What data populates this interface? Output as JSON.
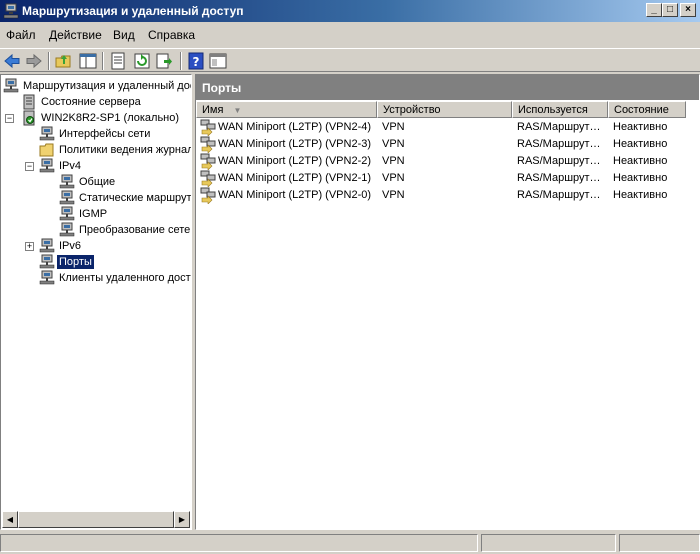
{
  "window": {
    "title": "Маршрутизация и удаленный доступ",
    "buttons": {
      "minimize": "_",
      "maximize": "□",
      "close": "×"
    }
  },
  "menu": [
    "Файл",
    "Действие",
    "Вид",
    "Справка"
  ],
  "toolbar": {
    "icons": [
      "back-arrow-icon",
      "forward-arrow-icon",
      "up-folder-icon",
      "show-tree-icon",
      "properties-icon",
      "refresh-icon",
      "export-icon",
      "help-icon",
      "console-icon"
    ],
    "accent": "#0a246a"
  },
  "tree": [
    {
      "label": "Маршрутизация и удаленный доступ",
      "icon": "server-tree-icon"
    },
    {
      "label": "Состояние сервера",
      "icon": "server-status-icon"
    },
    {
      "label": "WIN2K8R2-SP1 (локально)",
      "icon": "server-icon",
      "expander": "−"
    },
    {
      "label": "Интерфейсы сети",
      "icon": "network-icon"
    },
    {
      "label": "Политики ведения журнала",
      "icon": "folder-icon"
    },
    {
      "label": "IPv4",
      "icon": "network-icon",
      "expander": "−"
    },
    {
      "label": "Общие",
      "icon": "network-icon"
    },
    {
      "label": "Статические маршруты",
      "icon": "network-icon"
    },
    {
      "label": "IGMP",
      "icon": "network-icon"
    },
    {
      "label": "Преобразование сетевых адресов",
      "icon": "network-icon"
    },
    {
      "label": "IPv6",
      "icon": "network-icon",
      "expander": "+"
    },
    {
      "label": "Порты",
      "icon": "network-icon",
      "selected": true
    },
    {
      "label": "Клиенты удаленного доступа",
      "icon": "network-icon"
    }
  ],
  "right_pane": {
    "title": "Порты",
    "columns": [
      "Имя",
      "Устройство",
      "Используется",
      "Состояние"
    ],
    "sort_indicator": "▼",
    "rows": [
      {
        "name": "WAN Miniport (L2TP) (VPN2-4)",
        "device": "VPN",
        "used": "RAS/Маршрут…",
        "state": "Неактивно"
      },
      {
        "name": "WAN Miniport (L2TP) (VPN2-3)",
        "device": "VPN",
        "used": "RAS/Маршрут…",
        "state": "Неактивно"
      },
      {
        "name": "WAN Miniport (L2TP) (VPN2-2)",
        "device": "VPN",
        "used": "RAS/Маршрут…",
        "state": "Неактивно"
      },
      {
        "name": "WAN Miniport (L2TP) (VPN2-1)",
        "device": "VPN",
        "used": "RAS/Маршрут…",
        "state": "Неактивно"
      },
      {
        "name": "WAN Miniport (L2TP) (VPN2-0)",
        "device": "VPN",
        "used": "RAS/Маршрут…",
        "state": "Неактивно"
      }
    ]
  },
  "scrollbar": {
    "left": "◀",
    "right": "▶"
  }
}
